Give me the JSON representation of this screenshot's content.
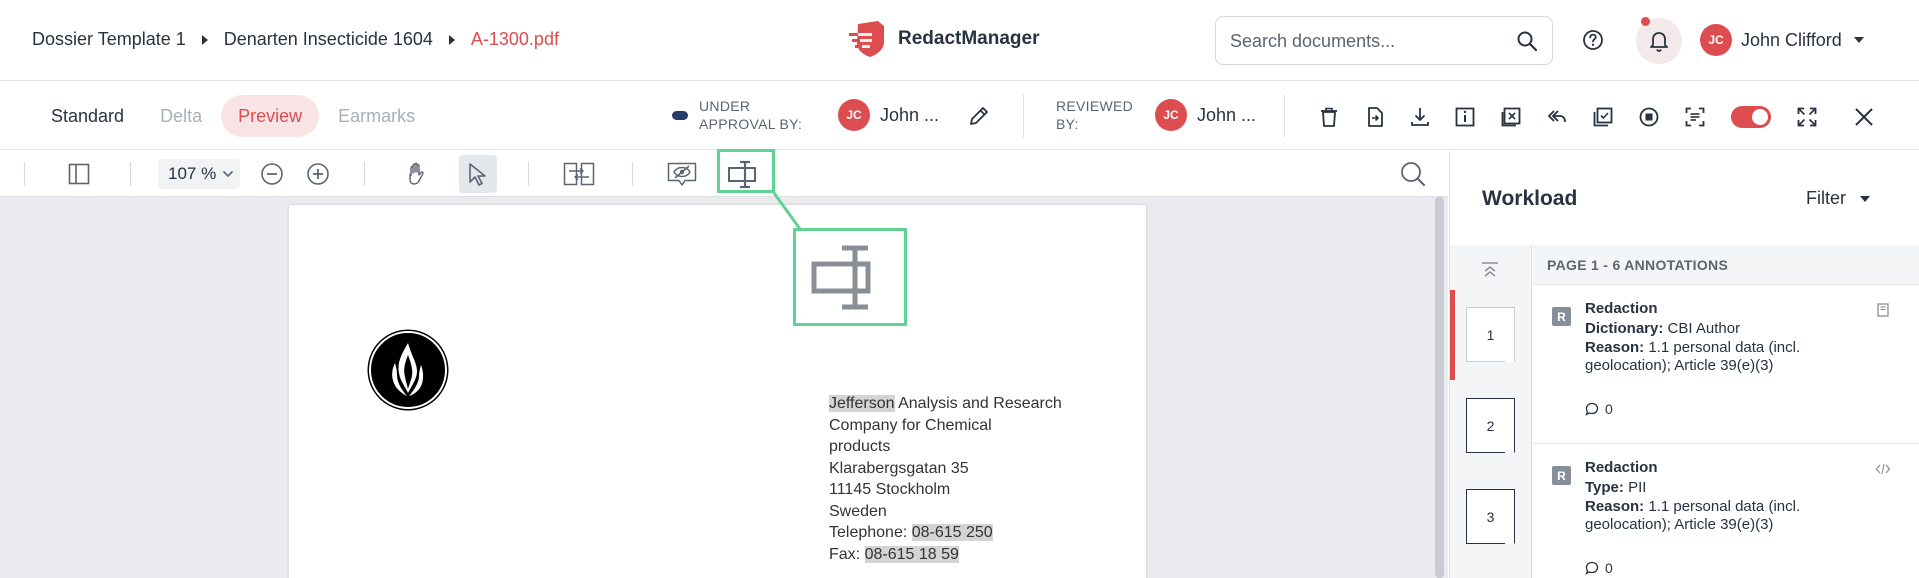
{
  "header": {
    "breadcrumb": [
      {
        "label": "Dossier Template 1"
      },
      {
        "label": "Denarten Insecticide 1604"
      },
      {
        "label": "A-1300.pdf"
      }
    ],
    "brand": "RedactManager",
    "search": {
      "placeholder": "Search documents..."
    },
    "user": {
      "name": "John Clifford",
      "initials": "JC"
    },
    "colors": {
      "accent": "#dd4d50",
      "text": "#283241",
      "highlight_green": "#5fd391"
    }
  },
  "subbar": {
    "tabs": [
      {
        "label": "Standard",
        "state": "normal"
      },
      {
        "label": "Delta",
        "state": "disabled"
      },
      {
        "label": "Preview",
        "state": "active"
      },
      {
        "label": "Earmarks",
        "state": "disabled"
      }
    ],
    "approval": {
      "label_line1": "UNDER",
      "label_line2": "APPROVAL BY:",
      "initials": "JC",
      "name": "John ..."
    },
    "review": {
      "label_line1": "REVIEWED",
      "label_line2": "BY:",
      "initials": "JC",
      "name": "John ..."
    },
    "toggle": {
      "on": true
    },
    "actions": [
      "trash-icon",
      "file-export-icon",
      "download-icon",
      "info-icon",
      "close-box-icon",
      "undo-icon",
      "copy-check-icon",
      "stop-icon",
      "scan-icon",
      "toggle",
      "fullscreen-icon",
      "close-icon"
    ]
  },
  "viewer_toolbar": {
    "zoom": "107 %",
    "tools": [
      "sidebar-toggle-icon",
      "zoom-out-icon",
      "zoom-in-icon",
      "pan-hand-icon",
      "select-arrow-icon",
      "compare-icon",
      "hide-annotations-icon",
      "text-select-icon",
      "search-icon"
    ],
    "selected": "select-arrow-icon"
  },
  "document": {
    "address": [
      {
        "text": "Jefferson",
        "highlight": true,
        "rest": " Analysis and Research"
      },
      {
        "text": "Company for Chemical"
      },
      {
        "text": "products"
      },
      {
        "text": "Klarabergsgatan 35"
      },
      {
        "text": "11145 Stockholm"
      },
      {
        "text": "Sweden"
      },
      {
        "prefix": "Telephone: ",
        "text": "08-615 250",
        "highlight": true
      },
      {
        "prefix": "Fax: ",
        "text": "08-615 18 59",
        "highlight": true
      }
    ]
  },
  "workload": {
    "title": "Workload",
    "filter": "Filter",
    "pages": [
      "1",
      "2",
      "3"
    ],
    "section_header": "PAGE 1 - 6 ANNOTATIONS",
    "annotations": [
      {
        "badge": "R",
        "type": "Redaction",
        "line1_key": "Dictionary:",
        "line1_val": " CBI Author",
        "reason_key": "Reason:",
        "reason_val": " 1.1 personal data (incl. geolocation); Article 39(e)(3)",
        "comments": "0"
      },
      {
        "badge": "R",
        "type": "Redaction",
        "line1_key": "Type:",
        "line1_val": " PII",
        "reason_key": "Reason:",
        "reason_val": " 1.1 personal data (incl. geolocation); Article 39(e)(3)",
        "comments": "0"
      }
    ]
  }
}
